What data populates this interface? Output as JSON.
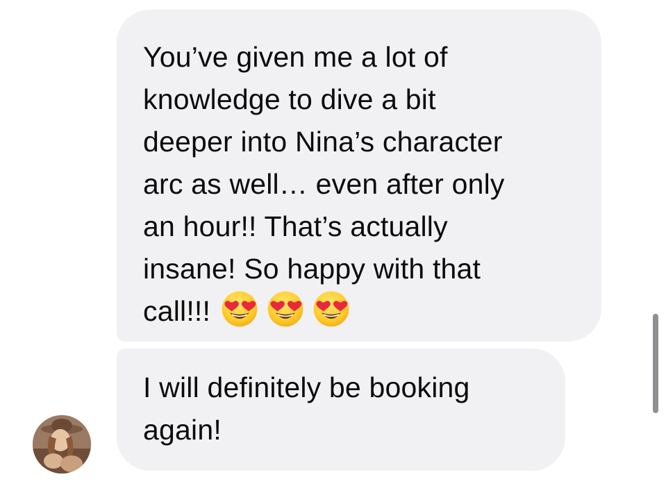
{
  "messages": [
    {
      "lines": [
        "You’ve given me a lot of",
        "knowledge to dive a bit",
        "deeper into Nina’s character",
        "arc as well… even after only",
        "an hour!! That’s actually",
        "insane! So happy with that",
        "call!!!"
      ],
      "emojis": [
        "heart-eyes-emoji",
        "heart-eyes-emoji",
        "heart-eyes-emoji"
      ]
    },
    {
      "lines": [
        "I will definitely be booking",
        "again!"
      ]
    }
  ],
  "avatar": {
    "icon": "user-avatar-photo"
  },
  "colors": {
    "bubble_background": "#f1f1f3",
    "text": "#0b0b0b",
    "scrollbar": "#8e8e93"
  }
}
